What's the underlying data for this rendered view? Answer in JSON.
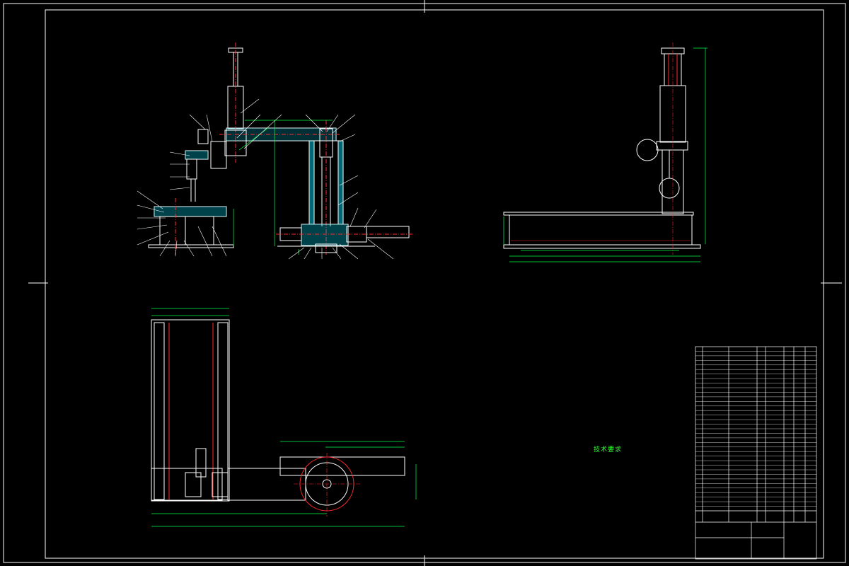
{
  "drawing": {
    "background": "#000000",
    "colors": {
      "line": "#ffffff",
      "part": "#00e5ff",
      "dimension": "#00ff44",
      "center": "#ff2a2a",
      "text": "#33ff33",
      "yellow": "#ffff33"
    }
  },
  "views": {
    "front": {
      "balloons": [
        "",
        "",
        "",
        "",
        "",
        "",
        "",
        "",
        "",
        "",
        "",
        "",
        "",
        "",
        "",
        "",
        "",
        "",
        ""
      ],
      "dim_labels": []
    },
    "side": {
      "dim_labels": []
    },
    "top": {
      "dim_labels": []
    }
  },
  "technical_requirements": {
    "title": "技术要求",
    "lines": [
      "",
      "",
      "",
      "",
      "",
      "",
      ""
    ]
  },
  "title_block": {
    "bom_rows": 36,
    "drawing_title": "",
    "drawing_name": ""
  }
}
